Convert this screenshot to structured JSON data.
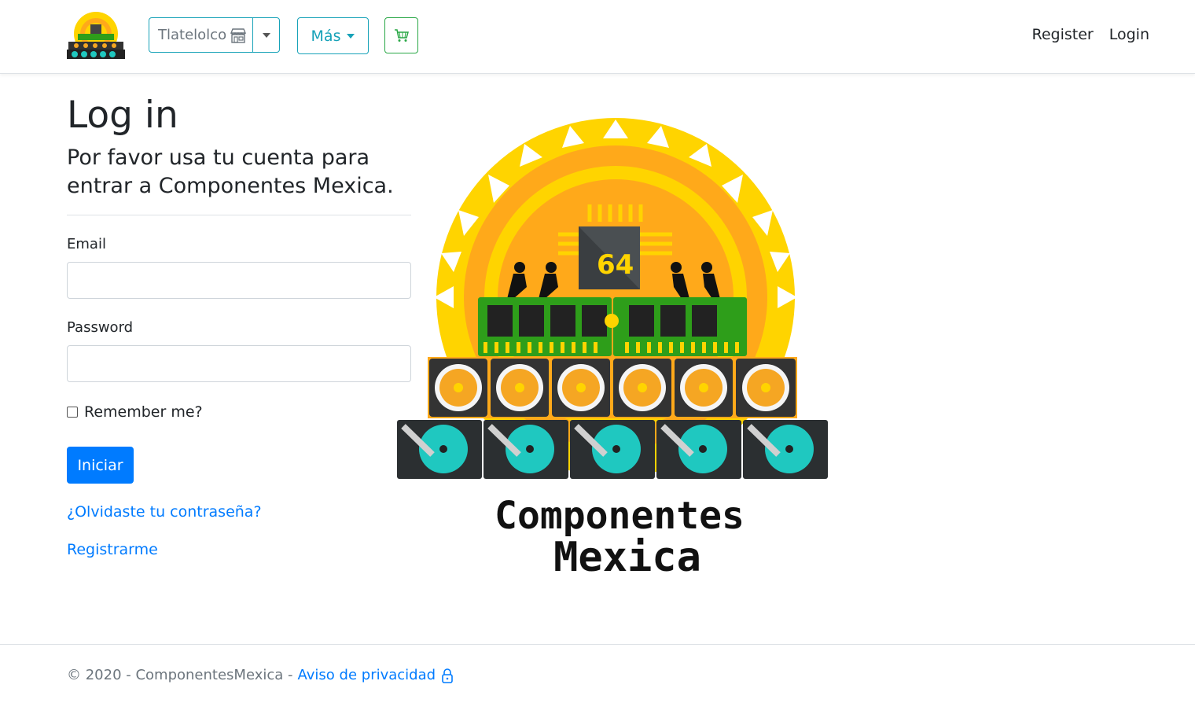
{
  "header": {
    "store_selector": {
      "selected": "Tlatelolco"
    },
    "more_menu_label": "Más",
    "nav": {
      "register": "Register",
      "login": "Login"
    }
  },
  "main": {
    "title": "Log in",
    "subtitle": "Por favor usa tu cuenta para entrar a Componentes Mexica.",
    "email_label": "Email",
    "email_value": "",
    "password_label": "Password",
    "password_value": "",
    "remember_label": "Remember me?",
    "remember_checked": false,
    "submit_label": "Iniciar",
    "forgot_link": "¿Olvidaste tu contraseña?",
    "register_link": "Registrarme"
  },
  "logo": {
    "line1": "Componentes",
    "line2": "Mexica",
    "chip_label": "64"
  },
  "footer": {
    "copyright": "© 2020 - ComponentesMexica -",
    "privacy_link": "Aviso de privacidad"
  },
  "colors": {
    "primary": "#007bff",
    "info": "#17a2b8",
    "success": "#28a745",
    "sun_yellow": "#ffd400",
    "sun_orange": "#ffa91a",
    "ram_green": "#2e9e1a",
    "fan_orange": "#f5a623",
    "disk_teal": "#1fc8c0"
  },
  "icons": {
    "store": "store-icon",
    "cart": "cart-icon",
    "lock": "lock-icon"
  }
}
